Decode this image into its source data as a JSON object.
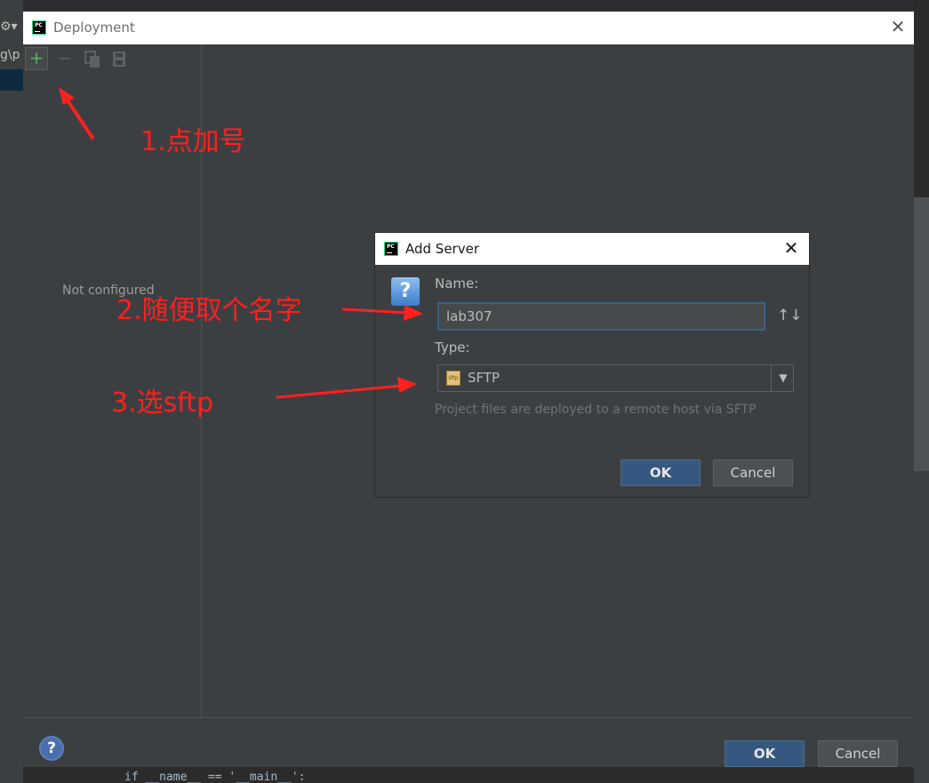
{
  "background": {
    "path_fragment": "g\\p",
    "code_fragment": "if __name__ == '__main__':"
  },
  "deployment": {
    "title": "Deployment",
    "logo_text": "PC",
    "not_configured": "Not configured",
    "ok_label": "OK",
    "cancel_label": "Cancel",
    "help_glyph": "?"
  },
  "add_server": {
    "title": "Add Server",
    "name_label": "Name:",
    "name_value": "lab307",
    "type_label": "Type:",
    "type_value": "SFTP",
    "type_icon_text": "sftp",
    "description": "Project files are deployed to a remote host via SFTP",
    "ok_label": "OK",
    "cancel_label": "Cancel"
  },
  "annotations": {
    "step1": "1.点加号",
    "step2": "2.随便取个名字",
    "step3": "3.选sftp"
  },
  "colors": {
    "accent": "#365880",
    "annotation": "#ff2020",
    "dialog_bg": "#3c3f41",
    "add_icon": "#59a869"
  }
}
